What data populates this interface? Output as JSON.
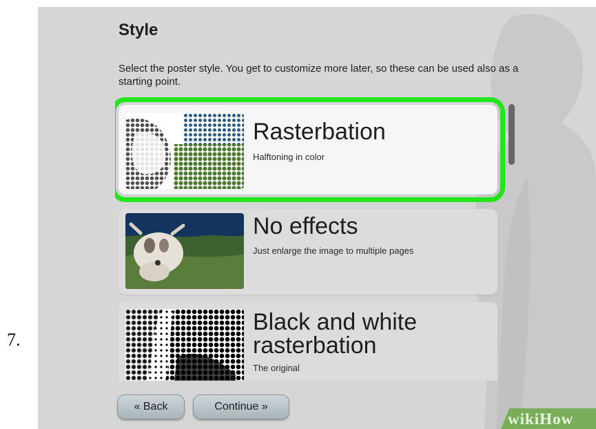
{
  "step_number": "7.",
  "page": {
    "heading": "Style",
    "description": "Select the poster style. You get to customize more later, so these can be used also as a starting point."
  },
  "styles": [
    {
      "title": "Rasterbation",
      "subtitle": "Halftoning in color",
      "selected": true
    },
    {
      "title": "No effects",
      "subtitle": "Just enlarge the image to multiple pages",
      "selected": false
    },
    {
      "title": "Black and white rasterbation",
      "subtitle": "The original",
      "selected": false
    }
  ],
  "buttons": {
    "back": "« Back",
    "continue": "Continue »"
  },
  "watermark": "wikiHow",
  "colors": {
    "selection_outline": "#22e51c",
    "background": "#d6d6d6",
    "watermark": "#79ad59"
  },
  "icons": {
    "scrollbar": "vertical-scrollbar-thumb"
  }
}
